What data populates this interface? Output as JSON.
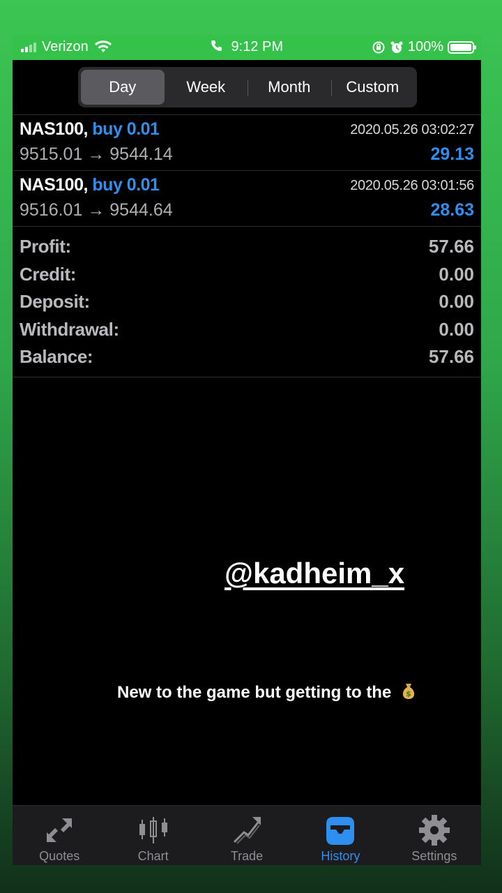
{
  "status_bar": {
    "carrier": "Verizon",
    "time": "9:12 PM",
    "battery": "100%"
  },
  "segments": [
    "Day",
    "Week",
    "Month",
    "Custom"
  ],
  "active_segment": "Day",
  "trades": [
    {
      "symbol": "NAS100,",
      "side": "buy 0.01",
      "datetime": "2020.05.26 03:02:27",
      "prices": "9515.01 → 9544.14",
      "profit": "29.13"
    },
    {
      "symbol": "NAS100,",
      "side": "buy 0.01",
      "datetime": "2020.05.26 03:01:56",
      "prices": "9516.01 → 9544.64",
      "profit": "28.63"
    }
  ],
  "summary": [
    {
      "label": "Profit:",
      "value": "57.66"
    },
    {
      "label": "Credit:",
      "value": "0.00"
    },
    {
      "label": "Deposit:",
      "value": "0.00"
    },
    {
      "label": "Withdrawal:",
      "value": "0.00"
    },
    {
      "label": "Balance:",
      "value": "57.66"
    }
  ],
  "overlay": {
    "handle": "@kadheim_x",
    "caption": "New to the game but getting to the"
  },
  "tabs": [
    {
      "label": "Quotes",
      "icon": "quotes-arrows-icon"
    },
    {
      "label": "Chart",
      "icon": "candlestick-chart-icon"
    },
    {
      "label": "Trade",
      "icon": "trade-trend-icon"
    },
    {
      "label": "History",
      "icon": "history-inbox-icon"
    },
    {
      "label": "Settings",
      "icon": "gear-icon"
    }
  ],
  "active_tab": "History",
  "colors": {
    "accent": "#2f8ff0",
    "background": "#000000",
    "frame_green": "#34c24a"
  }
}
